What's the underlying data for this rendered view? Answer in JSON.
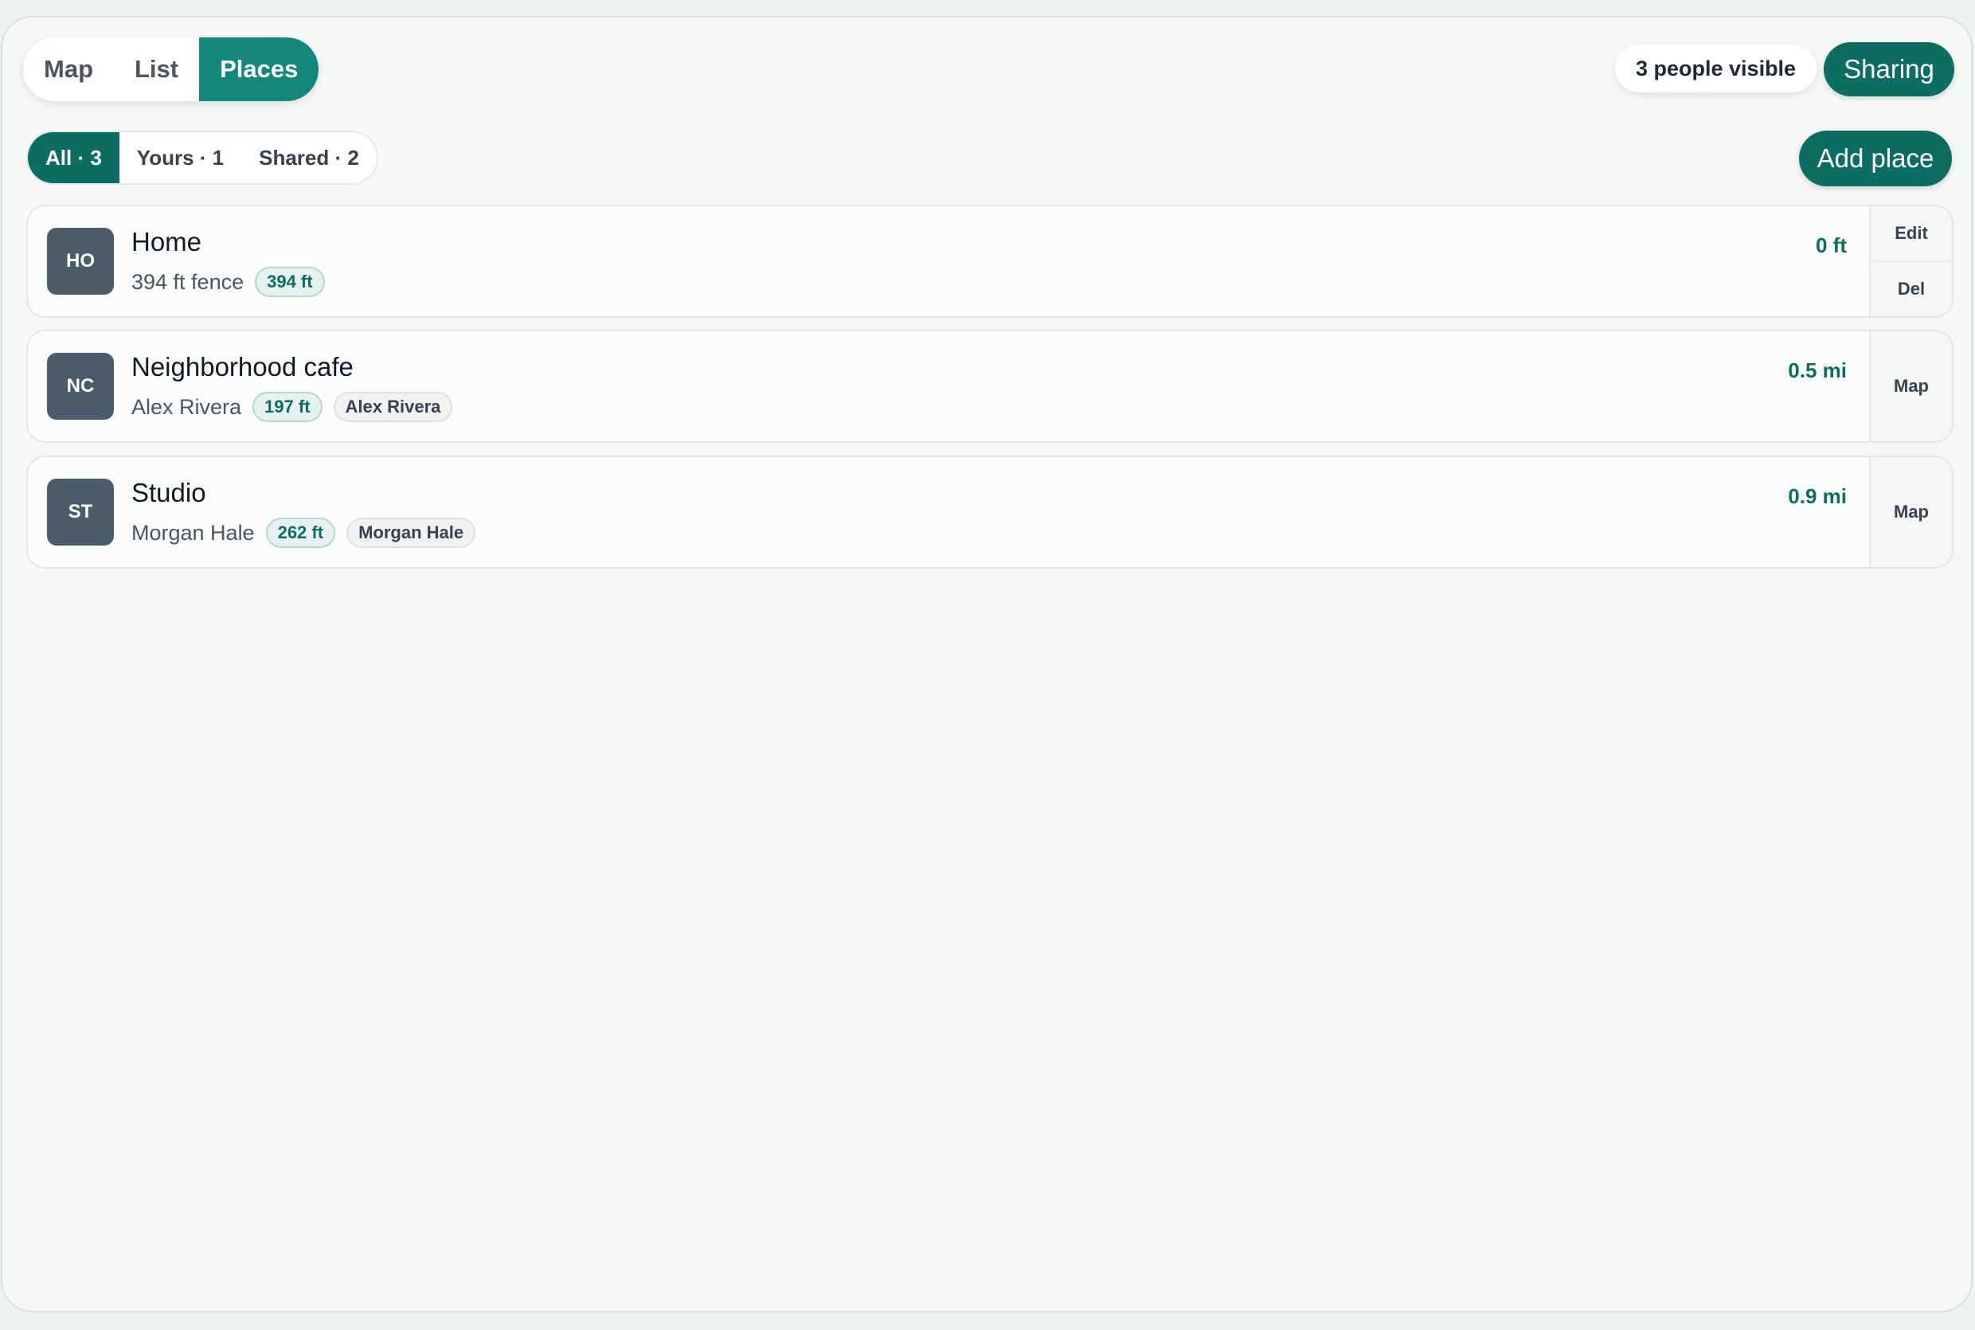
{
  "view_tabs": [
    {
      "label": "Map"
    },
    {
      "label": "List"
    },
    {
      "label": "Places"
    }
  ],
  "active_view": "Places",
  "people_visible": "3 people visible",
  "sharing_label": "Sharing",
  "filters": [
    {
      "label": "All · 3"
    },
    {
      "label": "Yours · 1"
    },
    {
      "label": "Shared · 2"
    }
  ],
  "add_place_label": "Add place",
  "places": [
    {
      "initials": "HO",
      "name": "Home",
      "subtitle": "394 ft fence",
      "radius_chip": "394 ft",
      "distance": "0 ft",
      "actions": [
        "Edit",
        "Del"
      ]
    },
    {
      "initials": "NC",
      "name": "Neighborhood cafe",
      "subtitle": "Alex Rivera",
      "radius_chip": "197 ft",
      "owner_chip": "Alex Rivera",
      "distance": "0.5 mi",
      "actions": [
        "Map"
      ]
    },
    {
      "initials": "ST",
      "name": "Studio",
      "subtitle": "Morgan Hale",
      "radius_chip": "262 ft",
      "owner_chip": "Morgan Hale",
      "distance": "0.9 mi",
      "actions": [
        "Map"
      ]
    }
  ],
  "colors": {
    "accent": "#0c6e62",
    "accent_light": "#14877b",
    "avatar": "#4a5b6c",
    "background": "#f6f8f7"
  }
}
